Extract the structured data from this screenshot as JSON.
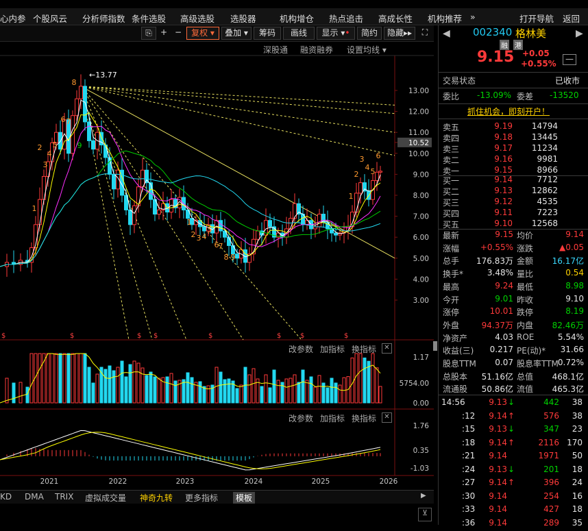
{
  "nav": [
    "心内参",
    "个股风云",
    "分析师指数",
    "条件选股",
    "高级选股",
    "选股器",
    "机构增仓",
    "热点追击",
    "高成长性",
    "机构推荐",
    "»",
    "打开导航",
    "返回"
  ],
  "toolbar": {
    "restore": "复权",
    "overlay": "叠加",
    "chips": "筹码",
    "draw": "画线",
    "display": "显示",
    "brief": "简约",
    "hide": "隐藏"
  },
  "subtool": {
    "deep": "深股通",
    "margin": "融资融券",
    "ma": "设置均线"
  },
  "price_axis": [
    "13.00",
    "12.00",
    "11.00",
    "10.52",
    "10.00",
    "9.00",
    "8.00",
    "7.00",
    "6.00",
    "5.00",
    "4.00",
    "3.00"
  ],
  "high_label": "13.77",
  "vol_axis": [
    "1.17",
    "5754.00",
    "0.00"
  ],
  "macd_axis": [
    "1.76",
    "0.35",
    "-1.03"
  ],
  "panel_tools": {
    "params": "改参数",
    "add": "加指标",
    "switch": "换指标",
    "close": "✕"
  },
  "years": [
    "2021",
    "2022",
    "2023",
    "2024",
    "2025",
    "2026"
  ],
  "bottom": [
    "KD",
    "DMA",
    "TRIX",
    "虚拟成交量",
    "神奇九转",
    "更多指标",
    "模板"
  ],
  "quote": {
    "code": "002340",
    "name": "格林美",
    "tag1": "融",
    "tag2": "港",
    "price": "9.15",
    "chg": "+0.05",
    "pct": "+0.55%",
    "status_label": "交易状态",
    "status": "已收市",
    "wb_label": "委比",
    "wb": "-13.09%",
    "wc_label": "委差",
    "wc": "-13520",
    "promo": "抓住机会，即刻开户！"
  },
  "asks": [
    {
      "l": "卖五",
      "p": "9.19",
      "v": "14794"
    },
    {
      "l": "卖四",
      "p": "9.18",
      "v": "13445"
    },
    {
      "l": "卖三",
      "p": "9.17",
      "v": "11234"
    },
    {
      "l": "卖二",
      "p": "9.16",
      "v": "9981"
    },
    {
      "l": "卖一",
      "p": "9.15",
      "v": "8966"
    }
  ],
  "bids": [
    {
      "l": "买一",
      "p": "9.14",
      "v": "7712"
    },
    {
      "l": "买二",
      "p": "9.13",
      "v": "12862"
    },
    {
      "l": "买三",
      "p": "9.12",
      "v": "4535"
    },
    {
      "l": "买四",
      "p": "9.11",
      "v": "7223"
    },
    {
      "l": "买五",
      "p": "9.10",
      "v": "12568"
    }
  ],
  "stats": [
    [
      "最新",
      "9.15",
      "red",
      "均价",
      "9.14",
      "red"
    ],
    [
      "涨幅",
      "+0.55%",
      "red",
      "涨跌",
      "▲0.05",
      "red"
    ],
    [
      "总手",
      "176.83万",
      "wht",
      "金额",
      "16.17亿",
      "cyn"
    ],
    [
      "换手*",
      "3.48%",
      "wht",
      "量比",
      "0.54",
      "yel"
    ],
    [
      "最高",
      "9.24",
      "red",
      "最低",
      "8.98",
      "grn"
    ],
    [
      "今开",
      "9.01",
      "grn",
      "昨收",
      "9.10",
      "wht"
    ],
    [
      "涨停",
      "10.01",
      "red",
      "跌停",
      "8.19",
      "grn"
    ],
    [
      "外盘",
      "94.37万",
      "red",
      "内盘",
      "82.46万",
      "grn"
    ],
    [
      "净资产",
      "4.03",
      "wht",
      "ROE",
      "5.54%",
      "wht"
    ],
    [
      "收益(三)",
      "0.217",
      "wht",
      "PE(动)*",
      "31.66",
      "wht"
    ],
    [
      "股息TTM",
      "0.07",
      "wht",
      "股息率TTM",
      "0.72%",
      "wht"
    ],
    [
      "总股本",
      "51.16亿",
      "wht",
      "总值",
      "468.1亿",
      "wht"
    ],
    [
      "流通股",
      "50.86亿",
      "wht",
      "流值",
      "465.3亿",
      "wht"
    ]
  ],
  "ticks": [
    {
      "t": "14:56",
      "p": "9.13",
      "d": "down",
      "v": "442",
      "n": "38"
    },
    {
      "t": ":12",
      "p": "9.14",
      "d": "up",
      "v": "576",
      "n": "38"
    },
    {
      "t": ":15",
      "p": "9.13",
      "d": "down",
      "v": "347",
      "n": "23"
    },
    {
      "t": ":18",
      "p": "9.14",
      "d": "up",
      "v": "2116",
      "n": "170"
    },
    {
      "t": ":21",
      "p": "9.14",
      "d": "",
      "v": "1971",
      "n": "50"
    },
    {
      "t": ":24",
      "p": "9.13",
      "d": "down",
      "v": "201",
      "n": "18"
    },
    {
      "t": ":27",
      "p": "9.14",
      "d": "up",
      "v": "396",
      "n": "24"
    },
    {
      "t": ":30",
      "p": "9.14",
      "d": "",
      "v": "254",
      "n": "16"
    },
    {
      "t": ":33",
      "p": "9.14",
      "d": "",
      "v": "427",
      "n": "18"
    },
    {
      "t": ":36",
      "p": "9.14",
      "d": "",
      "v": "289",
      "n": "35"
    }
  ],
  "colors": {
    "up": "#ff3a3a",
    "down": "#00d200",
    "bar_down": "#22d8f0",
    "ma5": "#ffffff",
    "ma10": "#ffff00",
    "ma20": "#ff30ff",
    "ma60": "#00cc00",
    "ma120": "#22d8f0"
  }
}
